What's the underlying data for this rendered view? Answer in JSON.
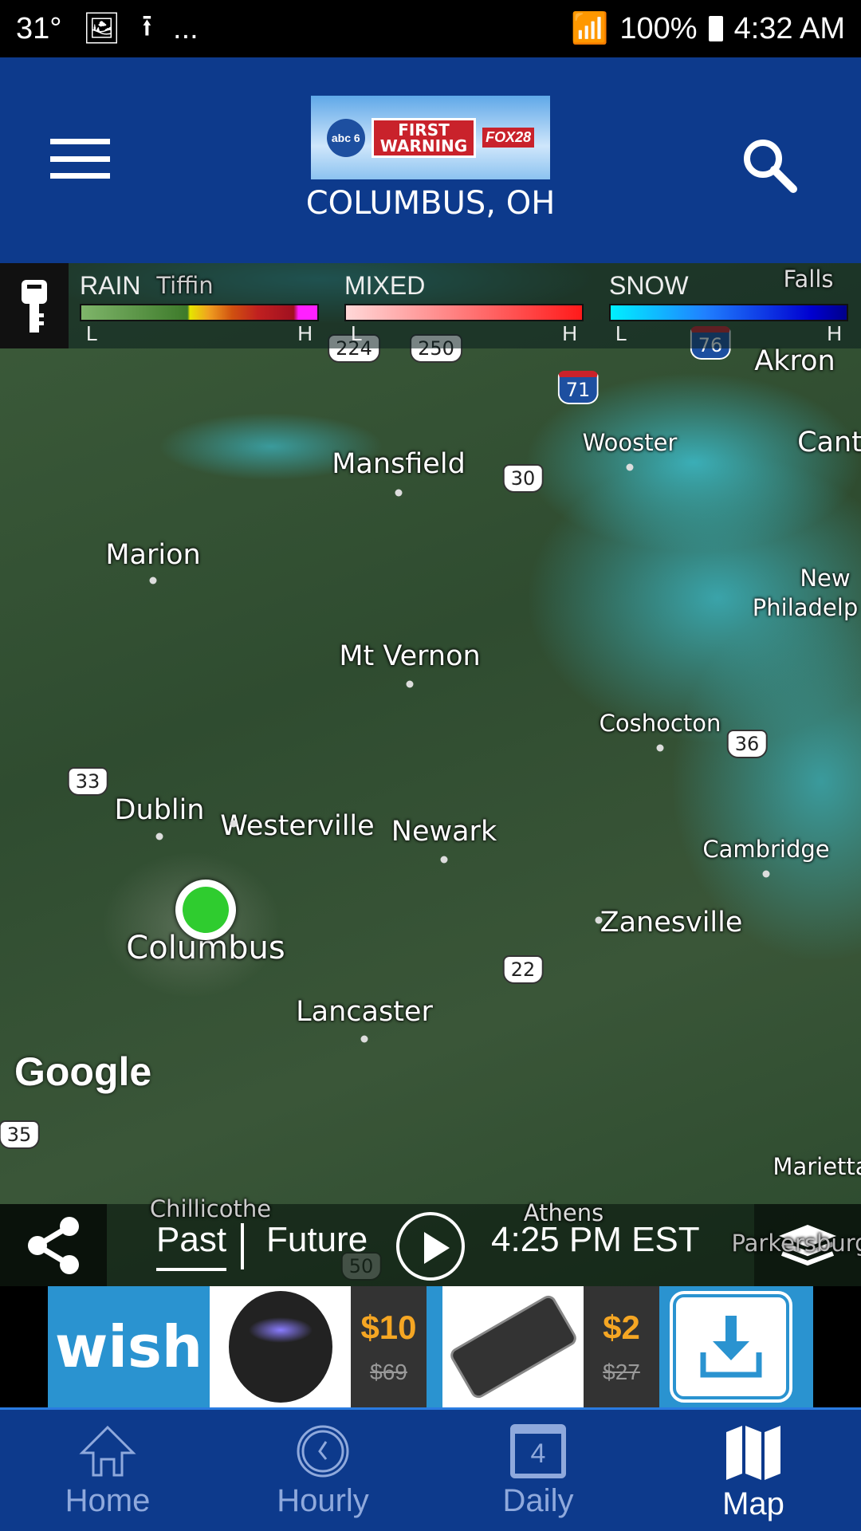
{
  "status_bar": {
    "temp": "31°",
    "icons": [
      "image-icon",
      "upload-icon",
      "more-icon",
      "wifi-icon",
      "signal-icon",
      "battery-icon"
    ],
    "more": "...",
    "battery": "100%",
    "time": "4:32 AM"
  },
  "header": {
    "logo": {
      "abc": "abc 6",
      "first": "FIRST",
      "warning": "WARNING",
      "fox": "FOX28"
    },
    "location": "COLUMBUS, OH",
    "brand_color": "#0d3a8c"
  },
  "legend": {
    "rain": {
      "label": "RAIN",
      "low": "L",
      "high": "H"
    },
    "mixed": {
      "label": "MIXED",
      "low": "L",
      "high": "H"
    },
    "snow": {
      "label": "SNOW",
      "low": "L",
      "high": "H"
    }
  },
  "map": {
    "cities": [
      "Tiffin",
      "Falls",
      "Akron",
      "Wooster",
      "Cant",
      "Mansfield",
      "Marion",
      "New",
      "Philadelp",
      "Mt Vernon",
      "Coshocton",
      "Dublin",
      "Westerville",
      "Newark",
      "Cambridge",
      "Zanesville",
      "Columbus",
      "Lancaster",
      "Marietta",
      "Chillicothe",
      "Athens",
      "Parkersburg"
    ],
    "highways": [
      "224",
      "250",
      "76",
      "71",
      "30",
      "33",
      "36",
      "22",
      "35",
      "50"
    ],
    "attribution": "Google"
  },
  "controls": {
    "past": "Past",
    "future": "Future",
    "time": "4:25 PM EST"
  },
  "ad": {
    "brand": "wish",
    "items": [
      {
        "price": "$10",
        "original": "$69"
      },
      {
        "price": "$2",
        "original": "$27"
      }
    ]
  },
  "nav": {
    "items": [
      {
        "label": "Home",
        "icon": "home-icon"
      },
      {
        "label": "Hourly",
        "icon": "clock-icon"
      },
      {
        "label": "Daily",
        "icon": "calendar-icon",
        "day": "4"
      },
      {
        "label": "Map",
        "icon": "map-icon",
        "active": true
      }
    ]
  }
}
